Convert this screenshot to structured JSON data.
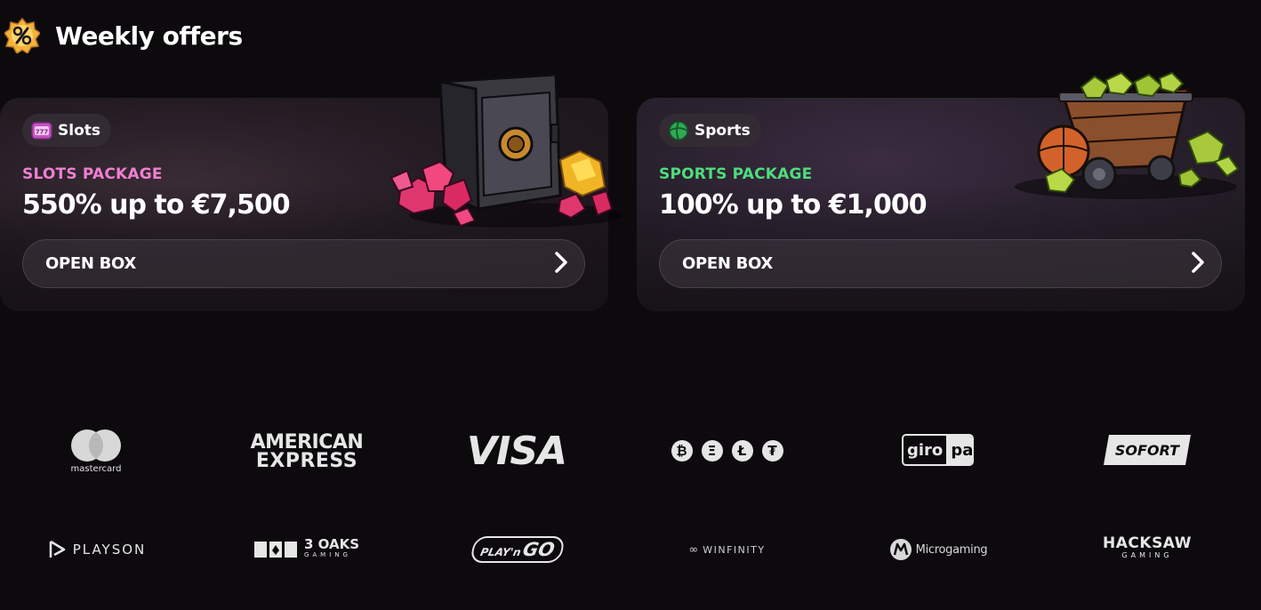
{
  "header": {
    "title": "Weekly offers",
    "icon": "percent-badge-icon"
  },
  "cards": [
    {
      "chip_label": "Slots",
      "chip_icon": "slot-machine-icon",
      "package_title": "SLOTS PACKAGE",
      "amount": "550% up to €7,500",
      "button_label": "OPEN BOX",
      "art": "safe-with-gems-image",
      "accent": "#ef7fd2"
    },
    {
      "chip_label": "Sports",
      "chip_icon": "ball-icon",
      "package_title": "SPORTS PACKAGE",
      "amount": "100% up to €1,000",
      "button_label": "OPEN BOX",
      "art": "mine-cart-with-basketball-image",
      "accent": "#4fdc7c"
    }
  ],
  "payment_logos": [
    {
      "name": "mastercard",
      "text": "mastercard"
    },
    {
      "name": "american-express",
      "line1": "AMERICAN",
      "line2": "EXPRESS"
    },
    {
      "name": "visa",
      "text": "VISA"
    },
    {
      "name": "crypto",
      "symbols": [
        "₿",
        "Ξ",
        "Ł",
        "₮"
      ]
    },
    {
      "name": "giropay",
      "left": "giro",
      "right": "pay"
    },
    {
      "name": "sofort",
      "text": "SOFORT"
    }
  ],
  "provider_logos": [
    {
      "name": "playson",
      "text": "PLAYSON"
    },
    {
      "name": "3-oaks",
      "line1": "3 OAKS",
      "line2": "GAMING"
    },
    {
      "name": "play-n-go",
      "left": "PLAY'n",
      "right": "GO"
    },
    {
      "name": "winfinity",
      "text": "WINFINITY"
    },
    {
      "name": "microgaming",
      "text": "Microgaming"
    },
    {
      "name": "hacksaw",
      "line1": "HACKSAW",
      "line2": "GAMING"
    }
  ]
}
